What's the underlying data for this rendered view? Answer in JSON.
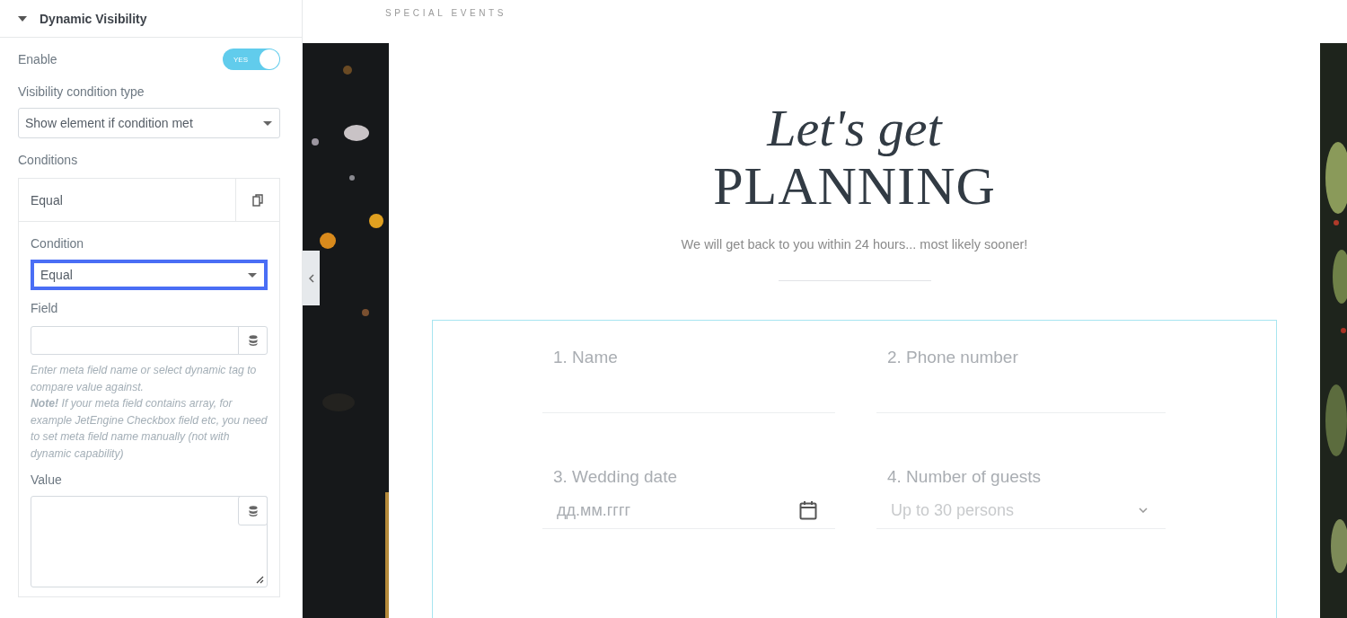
{
  "panel": {
    "section_title": "Dynamic Visibility",
    "expanded": true,
    "enable": {
      "label": "Enable",
      "on": true,
      "text": "YES"
    },
    "visibility_type": {
      "label": "Visibility condition type",
      "value": "Show element if condition met"
    },
    "conditions": {
      "label": "Conditions",
      "items": [
        {
          "title": "Equal",
          "condition": {
            "label": "Condition",
            "value": "Equal",
            "focused": true
          },
          "field": {
            "label": "Field"
          },
          "help": [
            "Enter meta field name or select dynamic tag to compare value against.",
            "**Note!** If your meta field contains array, for example JetEngine Checkbox field etc, you need to set meta field name manually (not with dynamic capability)"
          ],
          "value": {
            "label": "Value"
          }
        }
      ]
    }
  },
  "preview": {
    "brand": "SPECIAL EVENTS",
    "heading_script": "Let's get",
    "heading_caps": "PLANNING",
    "subtitle": "We will get back to you within 24 hours... most likely sooner!",
    "fields": [
      {
        "kind": "text",
        "label": "1. Name"
      },
      {
        "kind": "text",
        "label": "2. Phone number"
      },
      {
        "kind": "date",
        "label": "3. Wedding date",
        "placeholder": "дд.мм.гггг"
      },
      {
        "kind": "select",
        "label": "4. Number of guests",
        "value": "Up to 30 persons"
      }
    ]
  }
}
